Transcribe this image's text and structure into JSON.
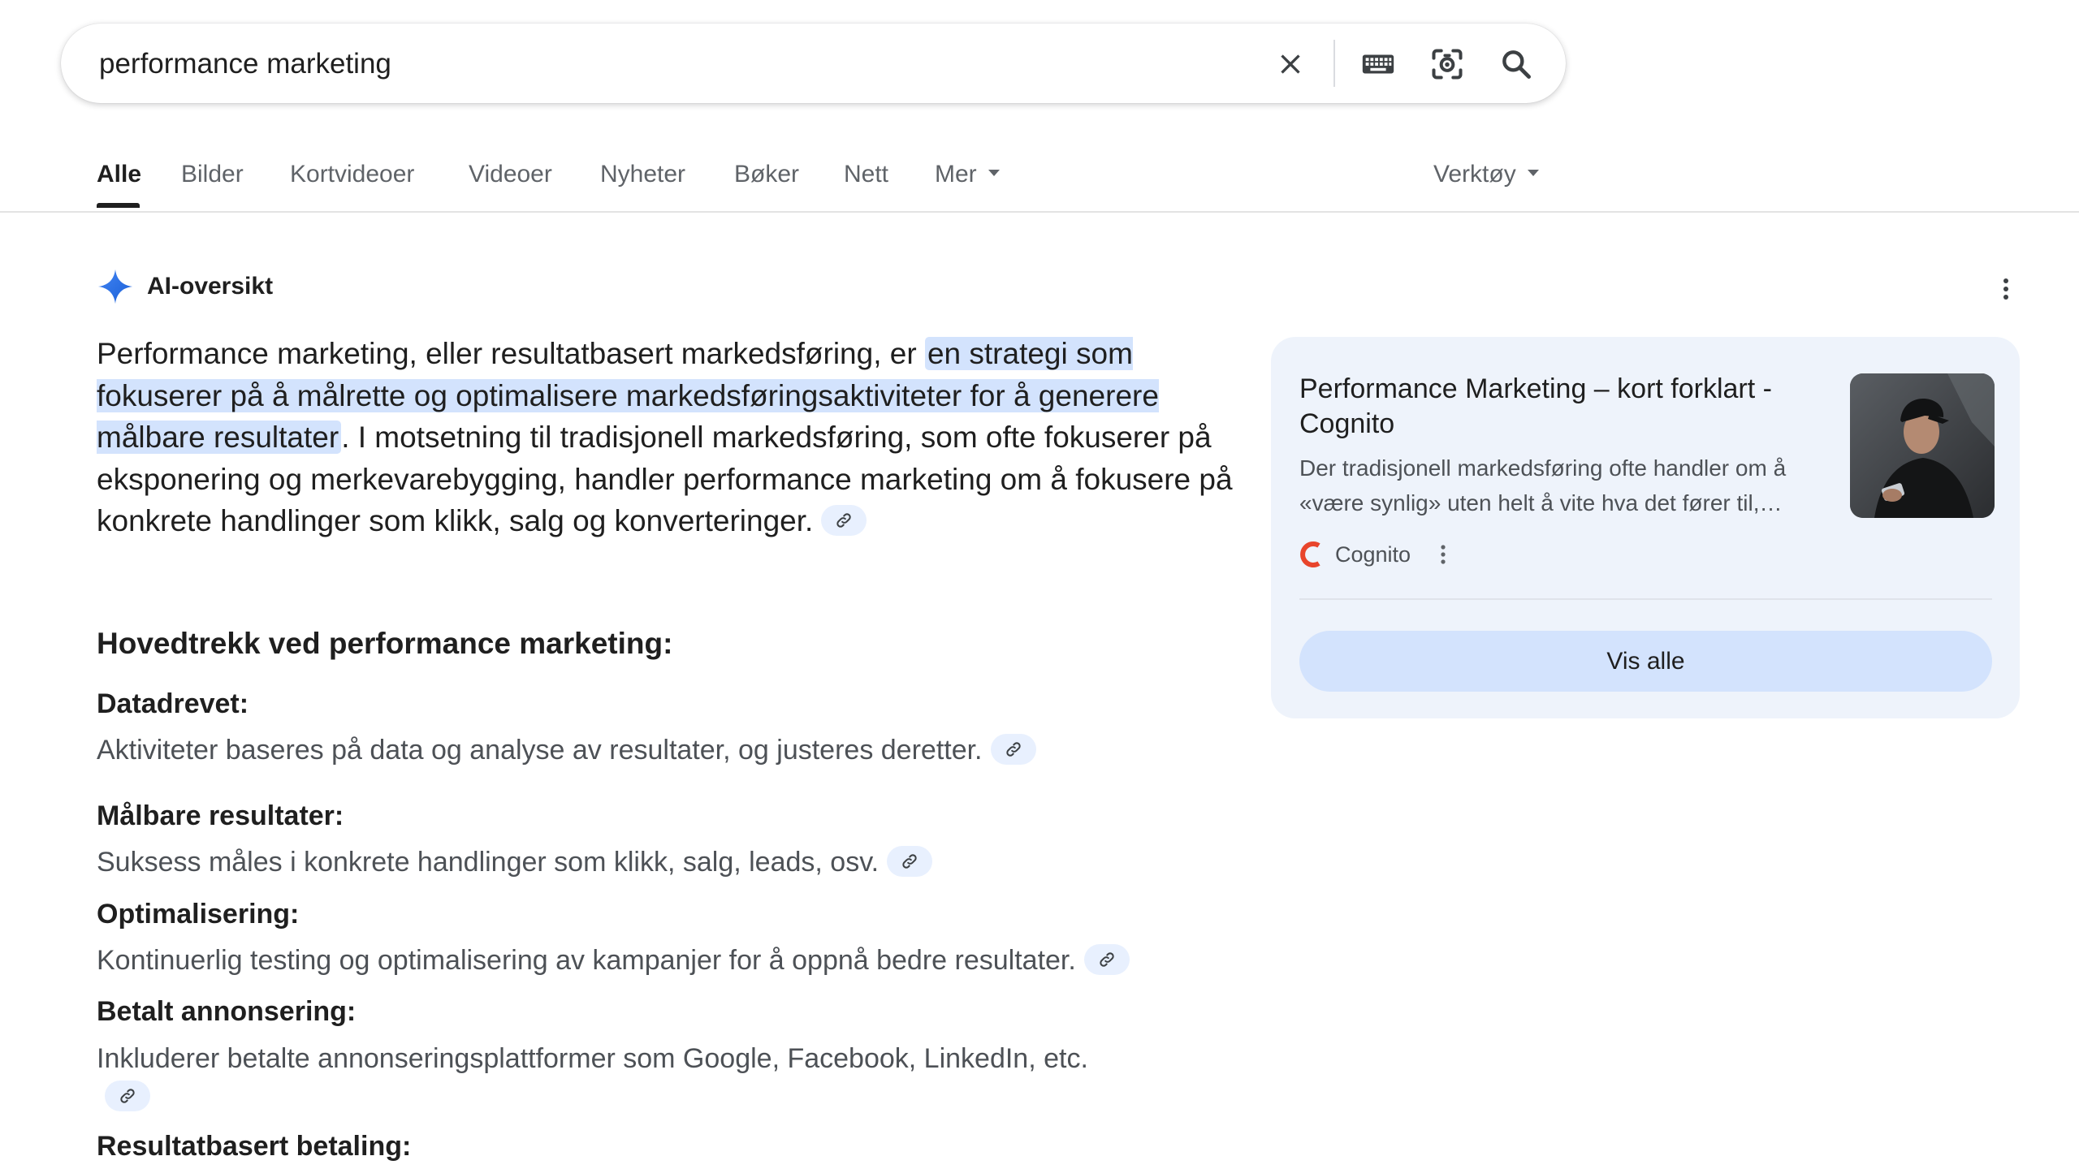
{
  "search": {
    "query": "performance marketing",
    "icons": [
      "close-icon",
      "keyboard-icon",
      "lens-icon",
      "search-icon"
    ]
  },
  "tabs": [
    {
      "label": "Alle",
      "active": true
    },
    {
      "label": "Bilder"
    },
    {
      "label": "Kortvideoer"
    },
    {
      "label": "Videoer"
    },
    {
      "label": "Nyheter"
    },
    {
      "label": "Bøker"
    },
    {
      "label": "Nett"
    },
    {
      "label": "Mer",
      "dropdown": true
    }
  ],
  "tools": {
    "label": "Verktøy"
  },
  "ai_overview": {
    "title": "AI-oversikt",
    "summary": {
      "before": "Performance marketing, eller resultatbasert markedsføring, er ",
      "highlight": "en strategi som fokuserer på å målrette og optimalisere markedsføringsaktiviteter for å generere målbare resultater",
      "after": ". I motsetning til tradisjonell markedsføring, som ofte fokuserer på eksponering og merkevarebygging, handler performance marketing om å fokusere på konkrete handlinger som klikk, salg og konverteringer."
    },
    "section_heading": "Hovedtrekk ved performance marketing:",
    "features": [
      {
        "title": "Datadrevet:",
        "desc": "Aktiviteter baseres på data og analyse av resultater, og justeres deretter."
      },
      {
        "title": "Målbare resultater:",
        "desc": "Suksess måles i konkrete handlinger som klikk, salg, leads, osv."
      },
      {
        "title": "Optimalisering:",
        "desc": "Kontinuerlig testing og optimalisering av kampanjer for å oppnå bedre resultater."
      },
      {
        "title": "Betalt annonsering:",
        "desc": "Inkluderer betalte annonseringsplattformer som Google, Facebook, LinkedIn, etc."
      },
      {
        "title": "Resultatbasert betaling:",
        "desc": ""
      }
    ]
  },
  "source_card": {
    "title": "Performance Marketing – kort forklart - Cognito",
    "snippet": "Der tradisjonell markedsføring ofte handler om å «være synlig» uten helt å vite hva det fører til,…",
    "source": "Cognito",
    "button": "Vis alle"
  },
  "colors": {
    "accent": "#1a73e8",
    "highlight": "#d3e3fd",
    "card_bg": "#eef3fb",
    "chip_bg": "#e8f0fe",
    "cognito_logo": "#e8452c"
  }
}
